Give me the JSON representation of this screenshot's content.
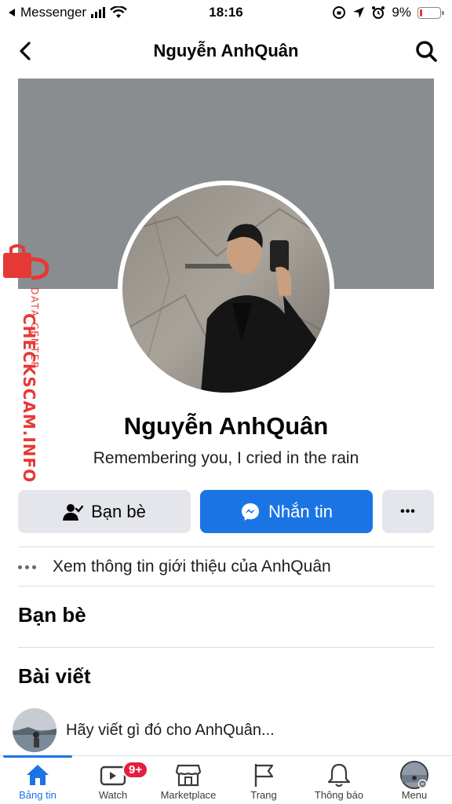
{
  "status_bar": {
    "back_app": "Messenger",
    "time": "18:16",
    "battery": "9%"
  },
  "header": {
    "title": "Nguyễn AnhQuân",
    "back_icon": "chevron-left-icon",
    "search_icon": "search-icon"
  },
  "watermark": {
    "brand": "CHECKSCAM.INFO",
    "sub": "DATA CENTER"
  },
  "profile": {
    "name": "Nguyễn AnhQuân",
    "bio": "Remembering you, I cried in the rain"
  },
  "actions": {
    "friends_label": "Bạn bè",
    "message_label": "Nhắn tin",
    "more_label": "•••"
  },
  "intro": {
    "text": "Xem thông tin giới thiệu của AnhQuân"
  },
  "sections": {
    "friends_title": "Bạn bè",
    "posts_title": "Bài viết"
  },
  "composer": {
    "prompt": "Hãy viết gì đó cho AnhQuân..."
  },
  "bottom_nav": {
    "items": [
      {
        "label": "Bảng tin",
        "icon": "home-icon"
      },
      {
        "label": "Watch",
        "icon": "watch-video-icon",
        "badge": "9+"
      },
      {
        "label": "Marketplace",
        "icon": "marketplace-icon"
      },
      {
        "label": "Trang",
        "icon": "flag-icon"
      },
      {
        "label": "Thông báo",
        "icon": "bell-icon"
      },
      {
        "label": "Menu",
        "icon": "avatar-menu-icon"
      }
    ]
  },
  "colors": {
    "accent": "#1b74e4",
    "button_gray": "#e4e6eb",
    "cover": "#8a8d90",
    "badge": "#e41e3f",
    "watermark": "#e53935"
  }
}
